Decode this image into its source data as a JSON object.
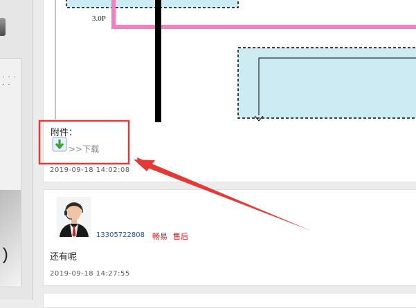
{
  "first_post": {
    "image_label": "3.0P",
    "attachment_label": "附件：",
    "attachment_link": ">>下载",
    "time": "2019-09-18 14:02:08"
  },
  "reply": {
    "username": "13305722808",
    "nickname": "畅易",
    "role": "售后",
    "body": "还有呢",
    "time": "2019-09-18 14:27:55"
  },
  "colors": {
    "highlight_red": "#e53935",
    "diagram_pink": "#f47fbf",
    "diagram_box_fill": "#cdebf2"
  },
  "icons": {
    "attachment": "download-arrow-icon",
    "avatar": "user-avatar-icon"
  }
}
